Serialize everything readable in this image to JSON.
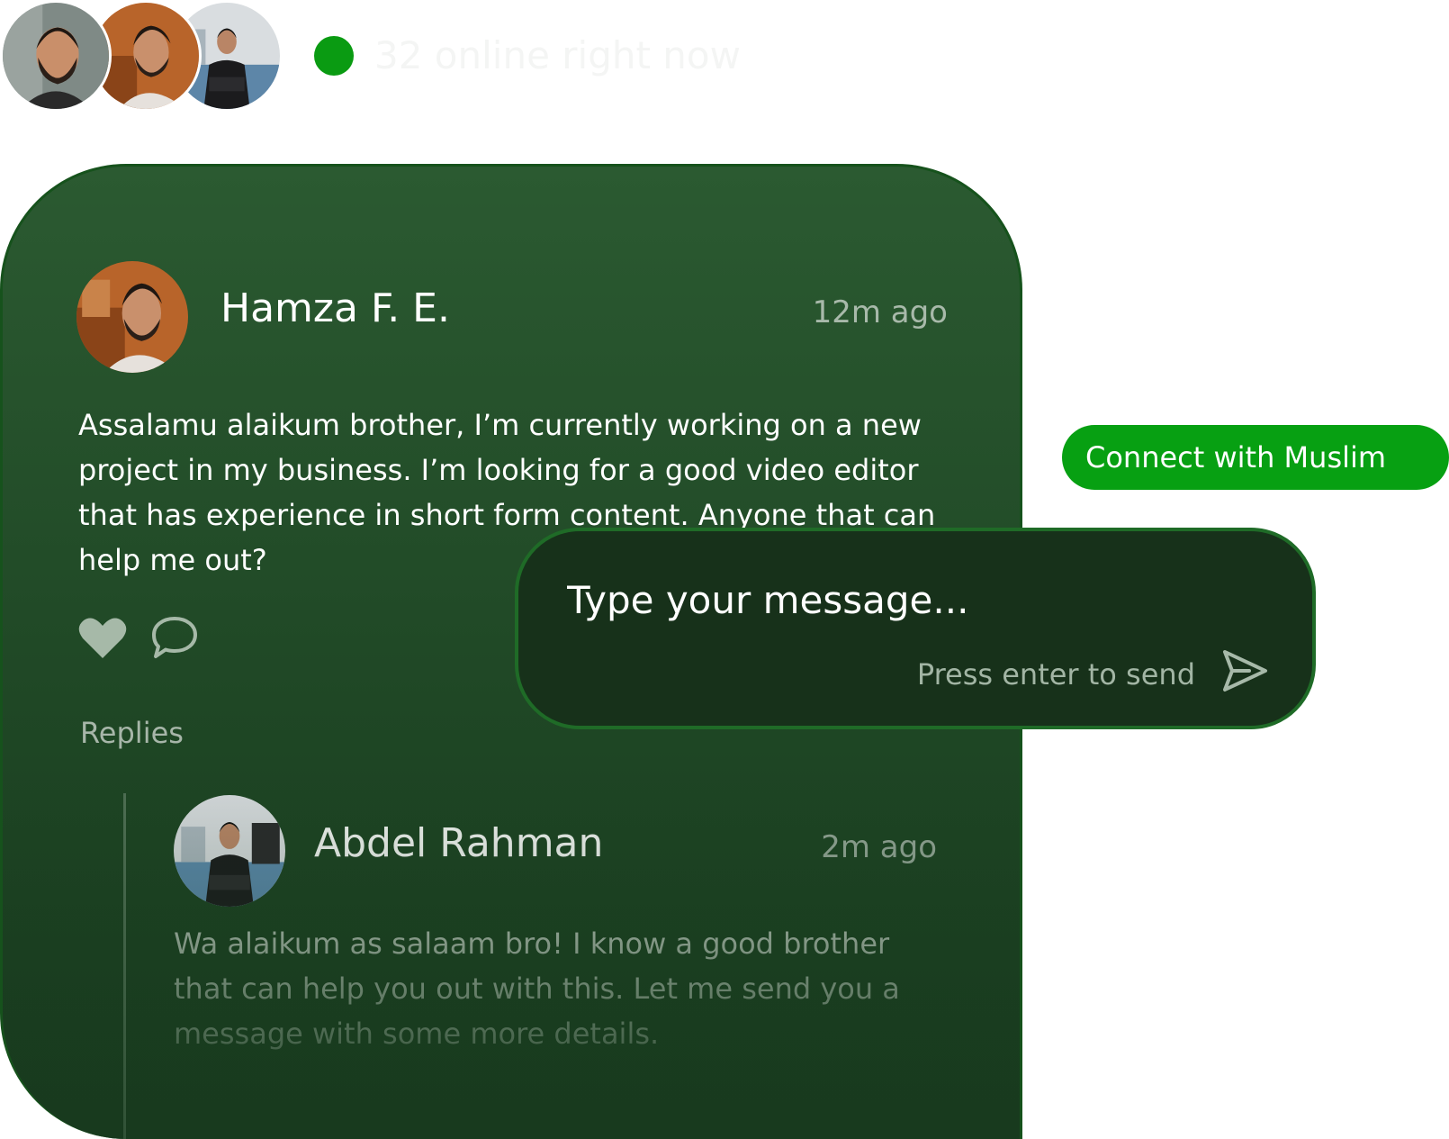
{
  "online": {
    "status_text": "32 online right now",
    "status_color": "#0a9b12",
    "avatars": [
      "avatar-bearded-man",
      "avatar-man-sweater",
      "avatar-man-office"
    ]
  },
  "post": {
    "author": "Hamza F. E.",
    "time": "12m ago",
    "body": "Assalamu alaikum brother, I’m currently working on a new project in my business. I’m looking for a good video editor that has experience in short form content. Anyone that can help me out?",
    "actions": {
      "like_icon": "heart-icon",
      "comment_icon": "comment-icon"
    },
    "replies_label": "Replies",
    "reply": {
      "author": "Abdel Rahman",
      "time": "2m ago",
      "body": "Wa alaikum as salaam bro! I know a good brother that can help you out with this. Let me send you a message with some more details."
    }
  },
  "connect": {
    "label": "Connect with Muslim",
    "color": "#07a012"
  },
  "composer": {
    "placeholder": "Type your message...",
    "value": "",
    "hint": "Press enter to send",
    "send_icon": "send-icon"
  },
  "theme": {
    "card_color": "#1f4725",
    "card_border": "#16521c",
    "composer_color": "#17311a"
  }
}
